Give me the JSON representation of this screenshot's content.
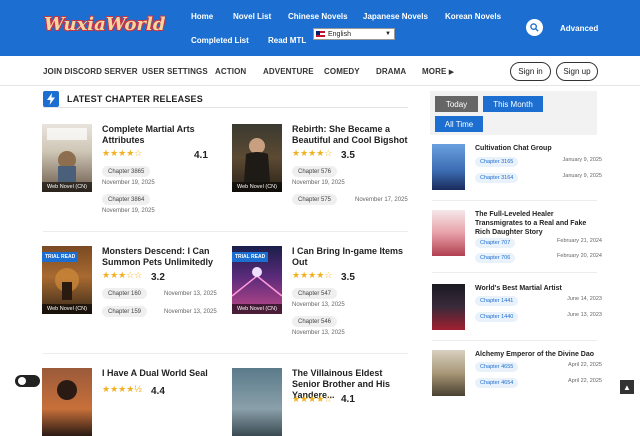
{
  "header": {
    "logo_text": "WuxiaWorld",
    "nav": [
      "Home",
      "Novel List",
      "Chinese Novels",
      "Japanese Novels",
      "Korean Novels",
      "Completed List",
      "Read MTL"
    ],
    "language": "English",
    "advanced": "Advanced"
  },
  "subnav": {
    "items": [
      "JOIN DISCORD SERVER",
      "USER SETTINGS",
      "ACTION",
      "ADVENTURE",
      "COMEDY",
      "DRAMA",
      "MORE"
    ],
    "signin": "Sign in",
    "signup": "Sign up"
  },
  "section": {
    "title": "LATEST CHAPTER RELEASES"
  },
  "novels": [
    {
      "title": "Complete Martial Arts Attributes",
      "stars": 4,
      "rating": "4.1",
      "cover_label": "Web Novel (CN)",
      "trial": "",
      "chapters": [
        {
          "label": "Chapter 3865",
          "date": "November 19, 2025"
        },
        {
          "label": "Chapter 3864",
          "date": "November 19, 2025"
        }
      ]
    },
    {
      "title": "Rebirth: She Became a Beautiful and Cool Bigshot",
      "stars": 3.5,
      "rating": "3.5",
      "cover_label": "Web Novel (CN)",
      "trial": "",
      "chapters": [
        {
          "label": "Chapter 576",
          "date": "November 19, 2025"
        },
        {
          "label": "Chapter 575",
          "date": "November 17, 2025"
        }
      ]
    },
    {
      "title": "Monsters Descend: I Can Summon Pets Unlimitedly",
      "stars": 3,
      "rating": "3.2",
      "cover_label": "Web Novel (CN)",
      "trial": "TRIAL READ",
      "chapters": [
        {
          "label": "Chapter 160",
          "date": "November 13, 2025"
        },
        {
          "label": "Chapter 159",
          "date": "November 13, 2025"
        }
      ]
    },
    {
      "title": "I Can Bring In-game Items Out",
      "stars": 3.5,
      "rating": "3.5",
      "cover_label": "Web Novel (CN)",
      "trial": "TRIAL READ",
      "chapters": [
        {
          "label": "Chapter 547",
          "date": "November 13, 2025"
        },
        {
          "label": "Chapter 546",
          "date": "November 13, 2025"
        }
      ]
    },
    {
      "title": "I Have A Dual World Seal",
      "stars": 4.5,
      "rating": "4.4",
      "cover_label": "",
      "trial": "",
      "chapters": []
    },
    {
      "title": "The Villainous Eldest Senior Brother and His Yandere...",
      "stars": 4,
      "rating": "4.1",
      "cover_label": "",
      "trial": "",
      "chapters": []
    }
  ],
  "sidebar": {
    "tabs": [
      "Today",
      "This Month",
      "All Time"
    ],
    "items": [
      {
        "title": "Cultivation Chat Group",
        "chapters": [
          {
            "label": "Chapter 3165",
            "date": "January 9, 2025"
          },
          {
            "label": "Chapter 3164",
            "date": "January 9, 2025"
          }
        ]
      },
      {
        "title": "The Full-Leveled Healer Transmigrates to a Real and Fake Rich Daughter Story",
        "chapters": [
          {
            "label": "Chapter 707",
            "date": "February 21, 2024"
          },
          {
            "label": "Chapter 706",
            "date": "February 20, 2024"
          }
        ]
      },
      {
        "title": "World's Best Martial Artist",
        "chapters": [
          {
            "label": "Chapter 1441",
            "date": "June 14, 2023"
          },
          {
            "label": "Chapter 1440",
            "date": "June 13, 2023"
          }
        ]
      },
      {
        "title": "Alchemy Emperor of the Divine Dao",
        "chapters": [
          {
            "label": "Chapter 4655",
            "date": "April 22, 2025"
          },
          {
            "label": "Chapter 4654",
            "date": "April 22, 2025"
          }
        ]
      }
    ]
  },
  "colors": {
    "brand": "#1c6fd0",
    "star": "#f2b01e"
  }
}
